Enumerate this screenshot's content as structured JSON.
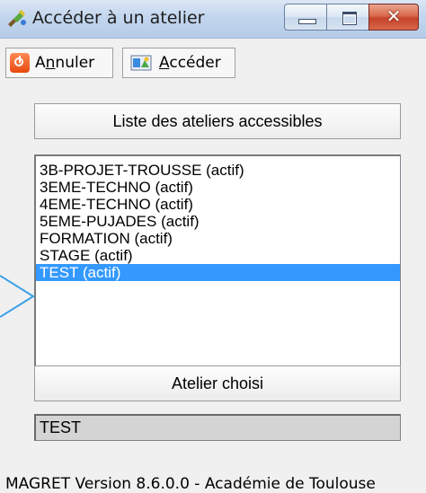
{
  "window": {
    "title": "Accéder à un atelier",
    "close_symbol": "✕"
  },
  "toolbar": {
    "cancel_label_pre": "A",
    "cancel_label_mnemonic": "n",
    "cancel_label_post": "nuler",
    "go_label_mnemonic": "A",
    "go_label_post": "ccéder"
  },
  "list_header": "Liste des ateliers accessibles",
  "workshops": [
    {
      "label": "3B-PROJET-TROUSSE (actif)",
      "selected": false
    },
    {
      "label": "3EME-TECHNO (actif)",
      "selected": false
    },
    {
      "label": "4EME-TECHNO (actif)",
      "selected": false
    },
    {
      "label": "5EME-PUJADES (actif)",
      "selected": false
    },
    {
      "label": "FORMATION (actif)",
      "selected": false
    },
    {
      "label": "STAGE (actif)",
      "selected": false
    },
    {
      "label": "TEST (actif)",
      "selected": true
    }
  ],
  "chosen_header": "Atelier choisi",
  "chosen_value": "TEST",
  "status_text": "MAGRET Version 8.6.0.0 - Académie de Toulouse",
  "colors": {
    "selection": "#3399ff",
    "pointer_arrow": "#3aa0e6"
  }
}
